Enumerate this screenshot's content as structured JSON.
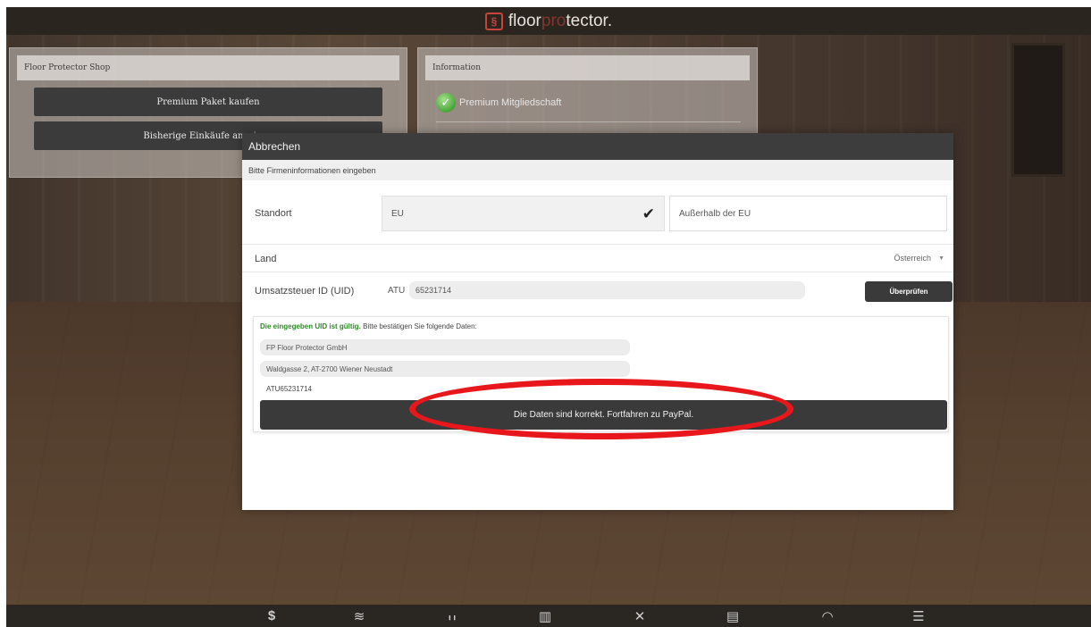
{
  "brand": {
    "logo_icon": "§",
    "name_left": "floor",
    "name_muted": "pro",
    "name_right": "tector.",
    "accent_color": "#c8443a"
  },
  "shop_panel": {
    "title": "Floor Protector Shop",
    "buy_button": "Premium Paket kaufen",
    "history_button": "Bisherige Einkäufe anzeigen"
  },
  "info_panel": {
    "title": "Information",
    "membership": "Premium Mitgliedschaft"
  },
  "modal": {
    "cancel_label": "Abbrechen",
    "subtitle": "Bitte Firmeninformationen eingeben",
    "standort_label": "Standort",
    "option_eu": "EU",
    "option_non_eu": "Außerhalb der EU",
    "land_label": "Land",
    "land_value": "Österreich",
    "uid_label": "Umsatzsteuer ID (UID)",
    "uid_prefix": "ATU",
    "uid_value": "65231714",
    "check_button": "Überprüfen",
    "valid_msg_bold": "Die eingegeben UID ist gültig.",
    "valid_msg_rest": " Bitte bestätigen Sie folgende Daten:",
    "company_name": "FP Floor Protector GmbH",
    "company_address": "Waldgasse 2, AT-2700 Wiener Neustadt",
    "company_uid": "ATU65231714",
    "proceed_button": "Die Daten sind korrekt. Fortfahren zu PayPal."
  },
  "bottom_nav": [
    {
      "name": "dollar-icon",
      "glyph": "$"
    },
    {
      "name": "layers-icon",
      "glyph": "≋"
    },
    {
      "name": "bar-chart-icon",
      "glyph": "╻╻"
    },
    {
      "name": "map-icon",
      "glyph": "▥"
    },
    {
      "name": "tools-icon",
      "glyph": "✕"
    },
    {
      "name": "clipboard-icon",
      "glyph": "▤"
    },
    {
      "name": "gauge-icon",
      "glyph": "◠"
    },
    {
      "name": "sliders-icon",
      "glyph": "☰"
    }
  ]
}
